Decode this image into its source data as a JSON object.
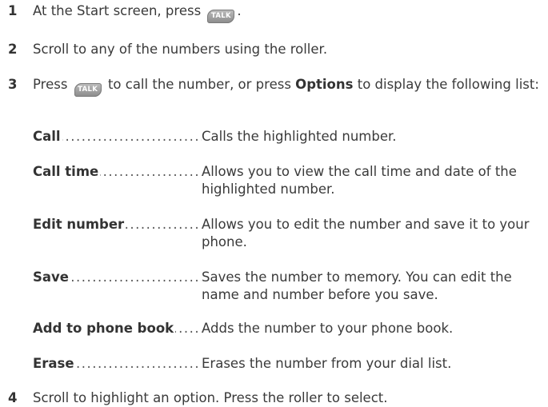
{
  "steps": [
    {
      "num": "1",
      "text_before": "At the Start screen, press",
      "key": "TALK",
      "text_after": "."
    },
    {
      "num": "2",
      "text": "Scroll to any of the numbers using the roller."
    },
    {
      "num": "3",
      "text_before": "Press",
      "key": "TALK",
      "text_mid": "to call the number, or press",
      "bold": "Options",
      "text_after": "to display the following list:"
    },
    {
      "num": "4",
      "text": "Scroll to highlight an option. Press the roller to select."
    }
  ],
  "options": [
    {
      "term": "Call",
      "desc": "Calls the highlighted number."
    },
    {
      "term": "Call time",
      "desc": "Allows you to view the call time and date of the highlighted number."
    },
    {
      "term": "Edit number",
      "desc": "Allows you to edit the number and save it to your phone."
    },
    {
      "term": "Save",
      "desc": "Saves the number to memory. You can edit the name and number before you save."
    },
    {
      "term": "Add to phone book",
      "desc": "Adds the number to your phone book."
    },
    {
      "term": "Erase",
      "desc": "Erases the number from your dial list."
    }
  ],
  "key_icon_name": "talk-key-icon"
}
